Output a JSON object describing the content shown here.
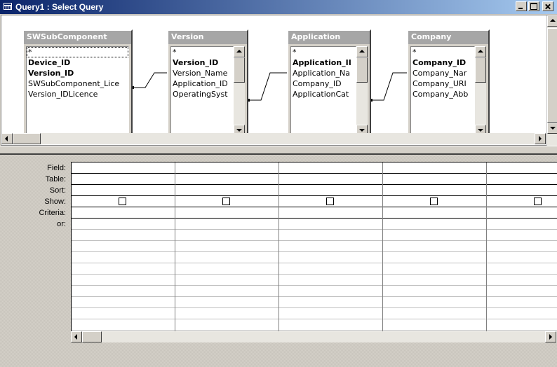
{
  "window": {
    "title": "Query1 : Select Query"
  },
  "tables": [
    {
      "name": "SWSubComponent",
      "fields": [
        "*",
        "Device_ID",
        "Version_ID",
        "SWSubComponent_Lice",
        "Version_IDLicence"
      ],
      "key_fields": [
        "Device_ID",
        "Version_ID"
      ]
    },
    {
      "name": "Version",
      "fields": [
        "*",
        "Version_ID",
        "Version_Name",
        "Application_ID",
        "OperatingSyst"
      ],
      "key_fields": [
        "Version_ID"
      ]
    },
    {
      "name": "Application",
      "fields": [
        "*",
        "Application_II",
        "Application_Na",
        "Company_ID",
        "ApplicationCat"
      ],
      "key_fields": [
        "Application_II"
      ]
    },
    {
      "name": "Company",
      "fields": [
        "*",
        "Company_ID",
        "Company_Nar",
        "Company_URI",
        "Company_Abb"
      ],
      "key_fields": [
        "Company_ID"
      ]
    }
  ],
  "grid": {
    "row_labels": [
      "Field:",
      "Table:",
      "Sort:",
      "Show:",
      "Criteria:",
      "or:"
    ],
    "columns": [
      {
        "field": "",
        "table": "",
        "sort": "",
        "show": false,
        "criteria": "",
        "or": ""
      },
      {
        "field": "",
        "table": "",
        "sort": "",
        "show": false,
        "criteria": "",
        "or": ""
      },
      {
        "field": "",
        "table": "",
        "sort": "",
        "show": false,
        "criteria": "",
        "or": ""
      },
      {
        "field": "",
        "table": "",
        "sort": "",
        "show": false,
        "criteria": "",
        "or": ""
      },
      {
        "field": "",
        "table": "",
        "sort": "",
        "show": false,
        "criteria": "",
        "or": ""
      }
    ]
  },
  "colors": {
    "title_start": "#0a246a",
    "title_end": "#a6caf0",
    "face": "#d4d0c8",
    "inactive_header": "#a6a6a6"
  }
}
